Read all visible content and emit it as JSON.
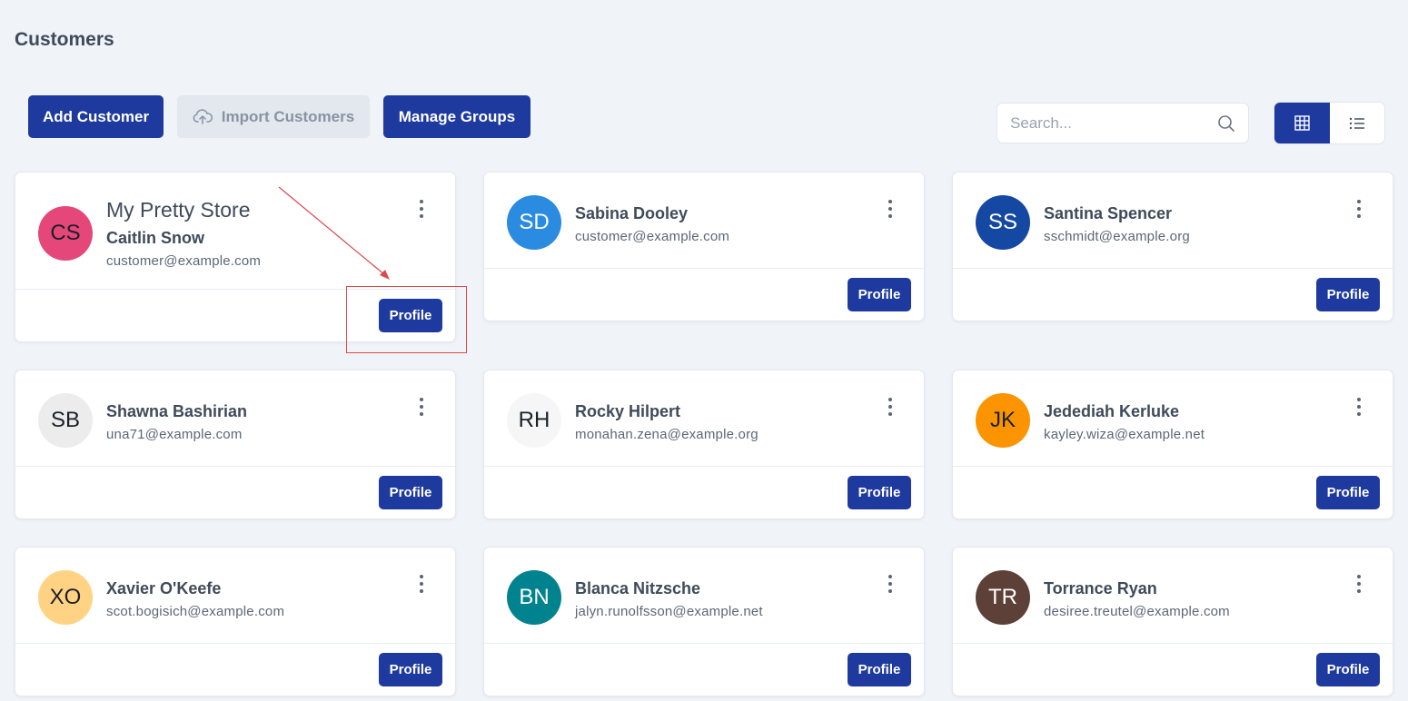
{
  "page": {
    "title": "Customers"
  },
  "toolbar": {
    "add_label": "Add Customer",
    "import_label": "Import Customers",
    "groups_label": "Manage Groups"
  },
  "search": {
    "placeholder": "Search...",
    "value": ""
  },
  "view_toggle": {
    "active": "grid",
    "icons": [
      "grid-icon",
      "list-icon"
    ]
  },
  "colors": {
    "primary": "#1e3a9e",
    "background": "#f0f3f8",
    "annotation": "#e0474c"
  },
  "customers": [
    {
      "initials": "CS",
      "store": "My Pretty Store",
      "name": "Caitlin Snow",
      "email": "customer@example.com",
      "avatar_color": "#e6477a",
      "profile_label": "Profile"
    },
    {
      "initials": "SD",
      "name": "Sabina Dooley",
      "email": "customer@example.com",
      "avatar_color": "#2a8be0",
      "profile_label": "Profile"
    },
    {
      "initials": "SS",
      "name": "Santina Spencer",
      "email": "sschmidt@example.org",
      "avatar_color": "#1548a3",
      "profile_label": "Profile"
    },
    {
      "initials": "SB",
      "name": "Shawna Bashirian",
      "email": "una71@example.com",
      "avatar_color": "#ececec",
      "profile_label": "Profile"
    },
    {
      "initials": "RH",
      "name": "Rocky Hilpert",
      "email": "monahan.zena@example.org",
      "avatar_color": "#f6f6f6",
      "profile_label": "Profile"
    },
    {
      "initials": "JK",
      "name": "Jedediah Kerluke",
      "email": "kayley.wiza@example.net",
      "avatar_color": "#fb9400",
      "profile_label": "Profile"
    },
    {
      "initials": "XO",
      "name": "Xavier O'Keefe",
      "email": "scot.bogisich@example.com",
      "avatar_color": "#ffd383",
      "profile_label": "Profile"
    },
    {
      "initials": "BN",
      "name": "Blanca Nitzsche",
      "email": "jalyn.runolfsson@example.net",
      "avatar_color": "#00838f",
      "profile_label": "Profile"
    },
    {
      "initials": "TR",
      "name": "Torrance Ryan",
      "email": "desiree.treutel@example.com",
      "avatar_color": "#5d4037",
      "profile_label": "Profile"
    }
  ]
}
